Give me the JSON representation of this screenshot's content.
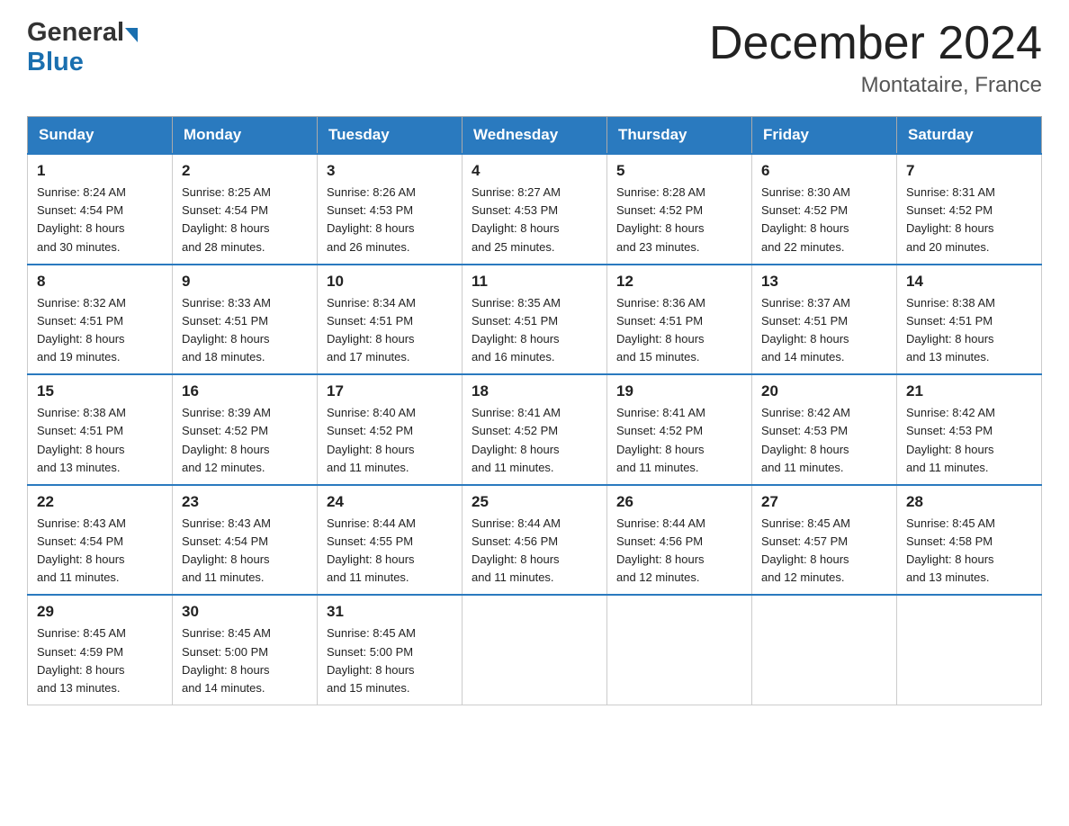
{
  "header": {
    "logo_line1": "General",
    "logo_line2": "Blue",
    "title": "December 2024",
    "subtitle": "Montataire, France"
  },
  "days_of_week": [
    "Sunday",
    "Monday",
    "Tuesday",
    "Wednesday",
    "Thursday",
    "Friday",
    "Saturday"
  ],
  "weeks": [
    [
      {
        "day": "1",
        "info": "Sunrise: 8:24 AM\nSunset: 4:54 PM\nDaylight: 8 hours\nand 30 minutes."
      },
      {
        "day": "2",
        "info": "Sunrise: 8:25 AM\nSunset: 4:54 PM\nDaylight: 8 hours\nand 28 minutes."
      },
      {
        "day": "3",
        "info": "Sunrise: 8:26 AM\nSunset: 4:53 PM\nDaylight: 8 hours\nand 26 minutes."
      },
      {
        "day": "4",
        "info": "Sunrise: 8:27 AM\nSunset: 4:53 PM\nDaylight: 8 hours\nand 25 minutes."
      },
      {
        "day": "5",
        "info": "Sunrise: 8:28 AM\nSunset: 4:52 PM\nDaylight: 8 hours\nand 23 minutes."
      },
      {
        "day": "6",
        "info": "Sunrise: 8:30 AM\nSunset: 4:52 PM\nDaylight: 8 hours\nand 22 minutes."
      },
      {
        "day": "7",
        "info": "Sunrise: 8:31 AM\nSunset: 4:52 PM\nDaylight: 8 hours\nand 20 minutes."
      }
    ],
    [
      {
        "day": "8",
        "info": "Sunrise: 8:32 AM\nSunset: 4:51 PM\nDaylight: 8 hours\nand 19 minutes."
      },
      {
        "day": "9",
        "info": "Sunrise: 8:33 AM\nSunset: 4:51 PM\nDaylight: 8 hours\nand 18 minutes."
      },
      {
        "day": "10",
        "info": "Sunrise: 8:34 AM\nSunset: 4:51 PM\nDaylight: 8 hours\nand 17 minutes."
      },
      {
        "day": "11",
        "info": "Sunrise: 8:35 AM\nSunset: 4:51 PM\nDaylight: 8 hours\nand 16 minutes."
      },
      {
        "day": "12",
        "info": "Sunrise: 8:36 AM\nSunset: 4:51 PM\nDaylight: 8 hours\nand 15 minutes."
      },
      {
        "day": "13",
        "info": "Sunrise: 8:37 AM\nSunset: 4:51 PM\nDaylight: 8 hours\nand 14 minutes."
      },
      {
        "day": "14",
        "info": "Sunrise: 8:38 AM\nSunset: 4:51 PM\nDaylight: 8 hours\nand 13 minutes."
      }
    ],
    [
      {
        "day": "15",
        "info": "Sunrise: 8:38 AM\nSunset: 4:51 PM\nDaylight: 8 hours\nand 13 minutes."
      },
      {
        "day": "16",
        "info": "Sunrise: 8:39 AM\nSunset: 4:52 PM\nDaylight: 8 hours\nand 12 minutes."
      },
      {
        "day": "17",
        "info": "Sunrise: 8:40 AM\nSunset: 4:52 PM\nDaylight: 8 hours\nand 11 minutes."
      },
      {
        "day": "18",
        "info": "Sunrise: 8:41 AM\nSunset: 4:52 PM\nDaylight: 8 hours\nand 11 minutes."
      },
      {
        "day": "19",
        "info": "Sunrise: 8:41 AM\nSunset: 4:52 PM\nDaylight: 8 hours\nand 11 minutes."
      },
      {
        "day": "20",
        "info": "Sunrise: 8:42 AM\nSunset: 4:53 PM\nDaylight: 8 hours\nand 11 minutes."
      },
      {
        "day": "21",
        "info": "Sunrise: 8:42 AM\nSunset: 4:53 PM\nDaylight: 8 hours\nand 11 minutes."
      }
    ],
    [
      {
        "day": "22",
        "info": "Sunrise: 8:43 AM\nSunset: 4:54 PM\nDaylight: 8 hours\nand 11 minutes."
      },
      {
        "day": "23",
        "info": "Sunrise: 8:43 AM\nSunset: 4:54 PM\nDaylight: 8 hours\nand 11 minutes."
      },
      {
        "day": "24",
        "info": "Sunrise: 8:44 AM\nSunset: 4:55 PM\nDaylight: 8 hours\nand 11 minutes."
      },
      {
        "day": "25",
        "info": "Sunrise: 8:44 AM\nSunset: 4:56 PM\nDaylight: 8 hours\nand 11 minutes."
      },
      {
        "day": "26",
        "info": "Sunrise: 8:44 AM\nSunset: 4:56 PM\nDaylight: 8 hours\nand 12 minutes."
      },
      {
        "day": "27",
        "info": "Sunrise: 8:45 AM\nSunset: 4:57 PM\nDaylight: 8 hours\nand 12 minutes."
      },
      {
        "day": "28",
        "info": "Sunrise: 8:45 AM\nSunset: 4:58 PM\nDaylight: 8 hours\nand 13 minutes."
      }
    ],
    [
      {
        "day": "29",
        "info": "Sunrise: 8:45 AM\nSunset: 4:59 PM\nDaylight: 8 hours\nand 13 minutes."
      },
      {
        "day": "30",
        "info": "Sunrise: 8:45 AM\nSunset: 5:00 PM\nDaylight: 8 hours\nand 14 minutes."
      },
      {
        "day": "31",
        "info": "Sunrise: 8:45 AM\nSunset: 5:00 PM\nDaylight: 8 hours\nand 15 minutes."
      },
      {
        "day": "",
        "info": ""
      },
      {
        "day": "",
        "info": ""
      },
      {
        "day": "",
        "info": ""
      },
      {
        "day": "",
        "info": ""
      }
    ]
  ]
}
